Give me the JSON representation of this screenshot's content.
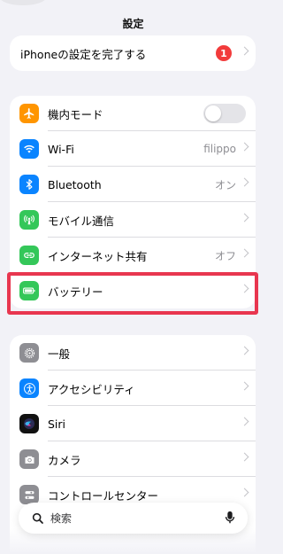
{
  "header": {
    "title": "設定"
  },
  "setup": {
    "label": "iPhoneの設定を完了する",
    "badge": "1"
  },
  "network": [
    {
      "label": "機内モード",
      "value": ""
    },
    {
      "label": "Wi-Fi",
      "value": "filippo"
    },
    {
      "label": "Bluetooth",
      "value": "オン"
    },
    {
      "label": "モバイル通信",
      "value": ""
    },
    {
      "label": "インターネット共有",
      "value": "オフ"
    },
    {
      "label": "バッテリー",
      "value": ""
    }
  ],
  "general": [
    {
      "label": "一般"
    },
    {
      "label": "アクセシビリティ"
    },
    {
      "label": "Siri"
    },
    {
      "label": "カメラ"
    },
    {
      "label": "コントロールセンター"
    }
  ],
  "search": {
    "placeholder": "検索"
  },
  "icons": {
    "airplane": "airplane-icon",
    "wifi": "wifi-icon",
    "bluetooth": "bluetooth-icon",
    "cellular": "cellular-icon",
    "hotspot": "hotspot-icon",
    "battery": "battery-icon",
    "general": "gear-icon",
    "accessibility": "accessibility-icon",
    "siri": "siri-icon",
    "camera": "camera-icon",
    "control-center": "control-center-icon"
  },
  "colors": {
    "airplane": "#ff9500",
    "wifi": "#0a84ff",
    "bluetooth": "#0a84ff",
    "cellular": "#34c759",
    "hotspot": "#34c759",
    "battery": "#34c759",
    "general": "#8e8e93",
    "accessibility": "#0a84ff",
    "camera": "#8e8e93",
    "control-center": "#8e8e93",
    "badge": "#f23b3b",
    "highlight": "#e8364f"
  }
}
